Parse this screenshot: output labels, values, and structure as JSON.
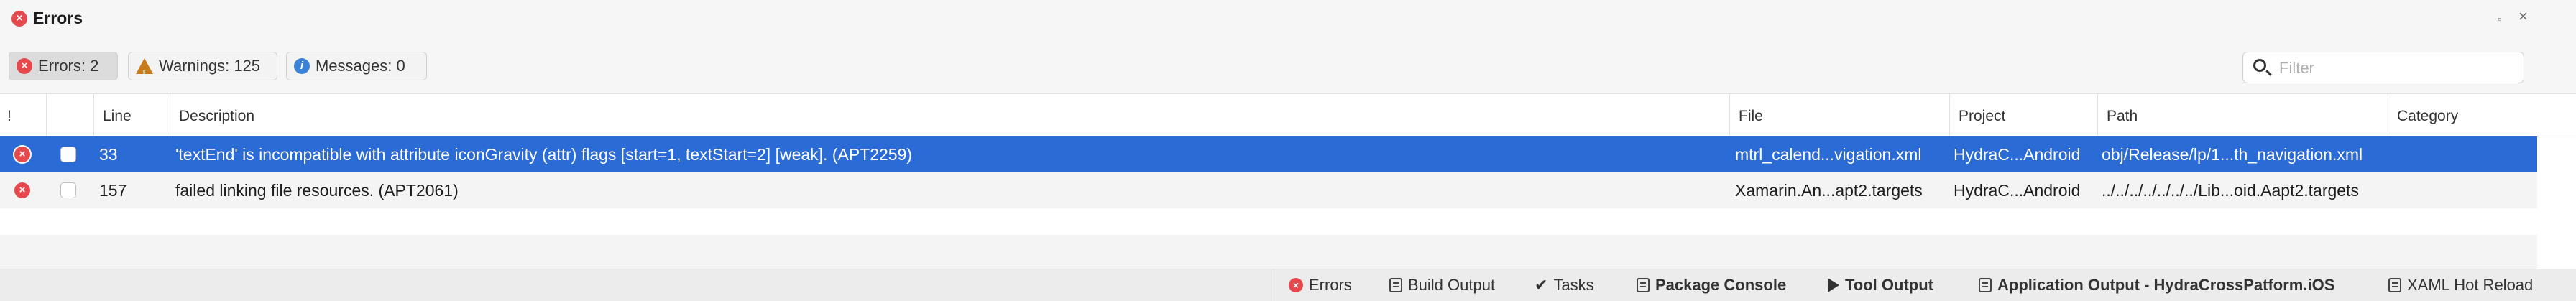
{
  "window": {
    "title": "Errors",
    "minimize_glyph": "▫",
    "close_glyph": "×",
    "title_icon_glyph": "×"
  },
  "filters": {
    "errors_label": "Errors: 2",
    "warnings_label": "Warnings: 125",
    "messages_label": "Messages: 0",
    "error_glyph": "×",
    "warning_glyph": "!",
    "info_glyph": "i",
    "search": {
      "placeholder": "Filter",
      "value": ""
    }
  },
  "table": {
    "columns": {
      "bang": "!",
      "line": "Line",
      "description": "Description",
      "file": "File",
      "project": "Project",
      "path": "Path",
      "category": "Category"
    },
    "rows": [
      {
        "line": "33",
        "description": "'textEnd' is incompatible with attribute iconGravity (attr) flags [start=1, textStart=2] [weak]. (APT2259)",
        "file": "mtrl_calend...vigation.xml",
        "project": "HydraC...Android",
        "path": "obj/Release/lp/1...th_navigation.xml",
        "category": "",
        "selected": true
      },
      {
        "line": "157",
        "description": "failed linking file resources. (APT2061)",
        "file": "Xamarin.An...apt2.targets",
        "project": "HydraC...Android",
        "path": "../../../../../../../Lib...oid.Aapt2.targets",
        "category": "",
        "selected": false
      }
    ]
  },
  "bottom_tabs": [
    {
      "label": "Errors",
      "icon": "error-icon"
    },
    {
      "label": "Build Output",
      "icon": "document-icon"
    },
    {
      "label": "Tasks",
      "icon": "checkmark-icon"
    },
    {
      "label": "Package Console",
      "icon": "document-icon"
    },
    {
      "label": "Tool Output",
      "icon": "play-icon"
    },
    {
      "label": "Application Output - HydraCrossPatform.iOS",
      "icon": "document-icon"
    },
    {
      "label": "XAML Hot Reload",
      "icon": "document-icon"
    }
  ],
  "colors": {
    "error": "#e5484d",
    "warning": "#c67c1a",
    "info": "#3b82d6",
    "selection": "#2a6bd6"
  }
}
